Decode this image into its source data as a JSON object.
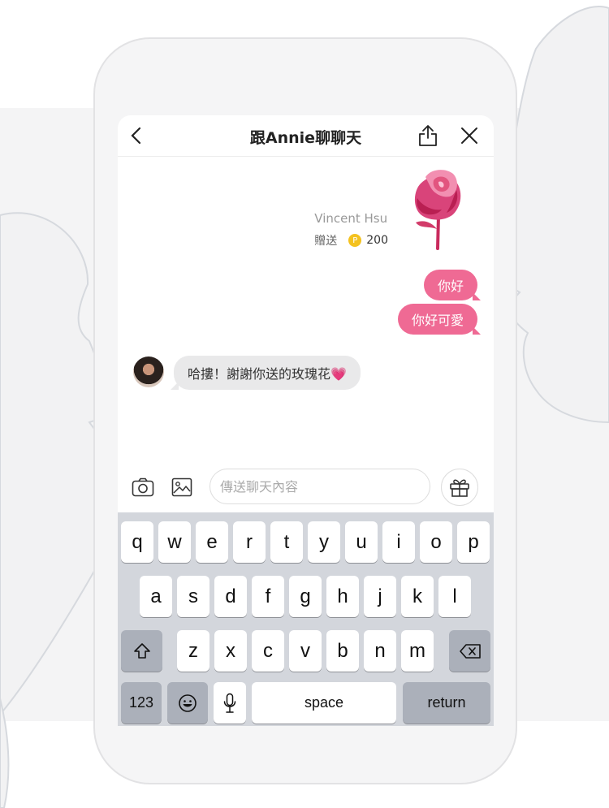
{
  "colors": {
    "accent": "#ef6a94",
    "coin": "#f4c21f",
    "keyboard_bg": "#d3d6dc"
  },
  "header": {
    "back_icon": "chevron-left-icon",
    "title": "跟Annie聊聊天",
    "share_icon": "share-icon",
    "close_icon": "close-icon"
  },
  "gift": {
    "sender": "Vincent Hsu",
    "action": "贈送",
    "coin_letter": "P",
    "amount": "200",
    "image_icon": "rose-icon"
  },
  "messages": {
    "outgoing": [
      "你好",
      "你好可愛"
    ],
    "incoming": "哈摟！謝謝你送的玫瑰花💗"
  },
  "input_bar": {
    "camera_icon": "camera-icon",
    "image_icon": "image-icon",
    "placeholder": "傳送聊天內容",
    "value": "",
    "gift_icon": "gift-icon"
  },
  "keyboard": {
    "row1": [
      "q",
      "w",
      "e",
      "r",
      "t",
      "y",
      "u",
      "i",
      "o",
      "p"
    ],
    "row2": [
      "a",
      "s",
      "d",
      "f",
      "g",
      "h",
      "j",
      "k",
      "l"
    ],
    "row3": [
      "z",
      "x",
      "c",
      "v",
      "b",
      "n",
      "m"
    ],
    "numbers": "123",
    "space": "space",
    "return": "return"
  }
}
